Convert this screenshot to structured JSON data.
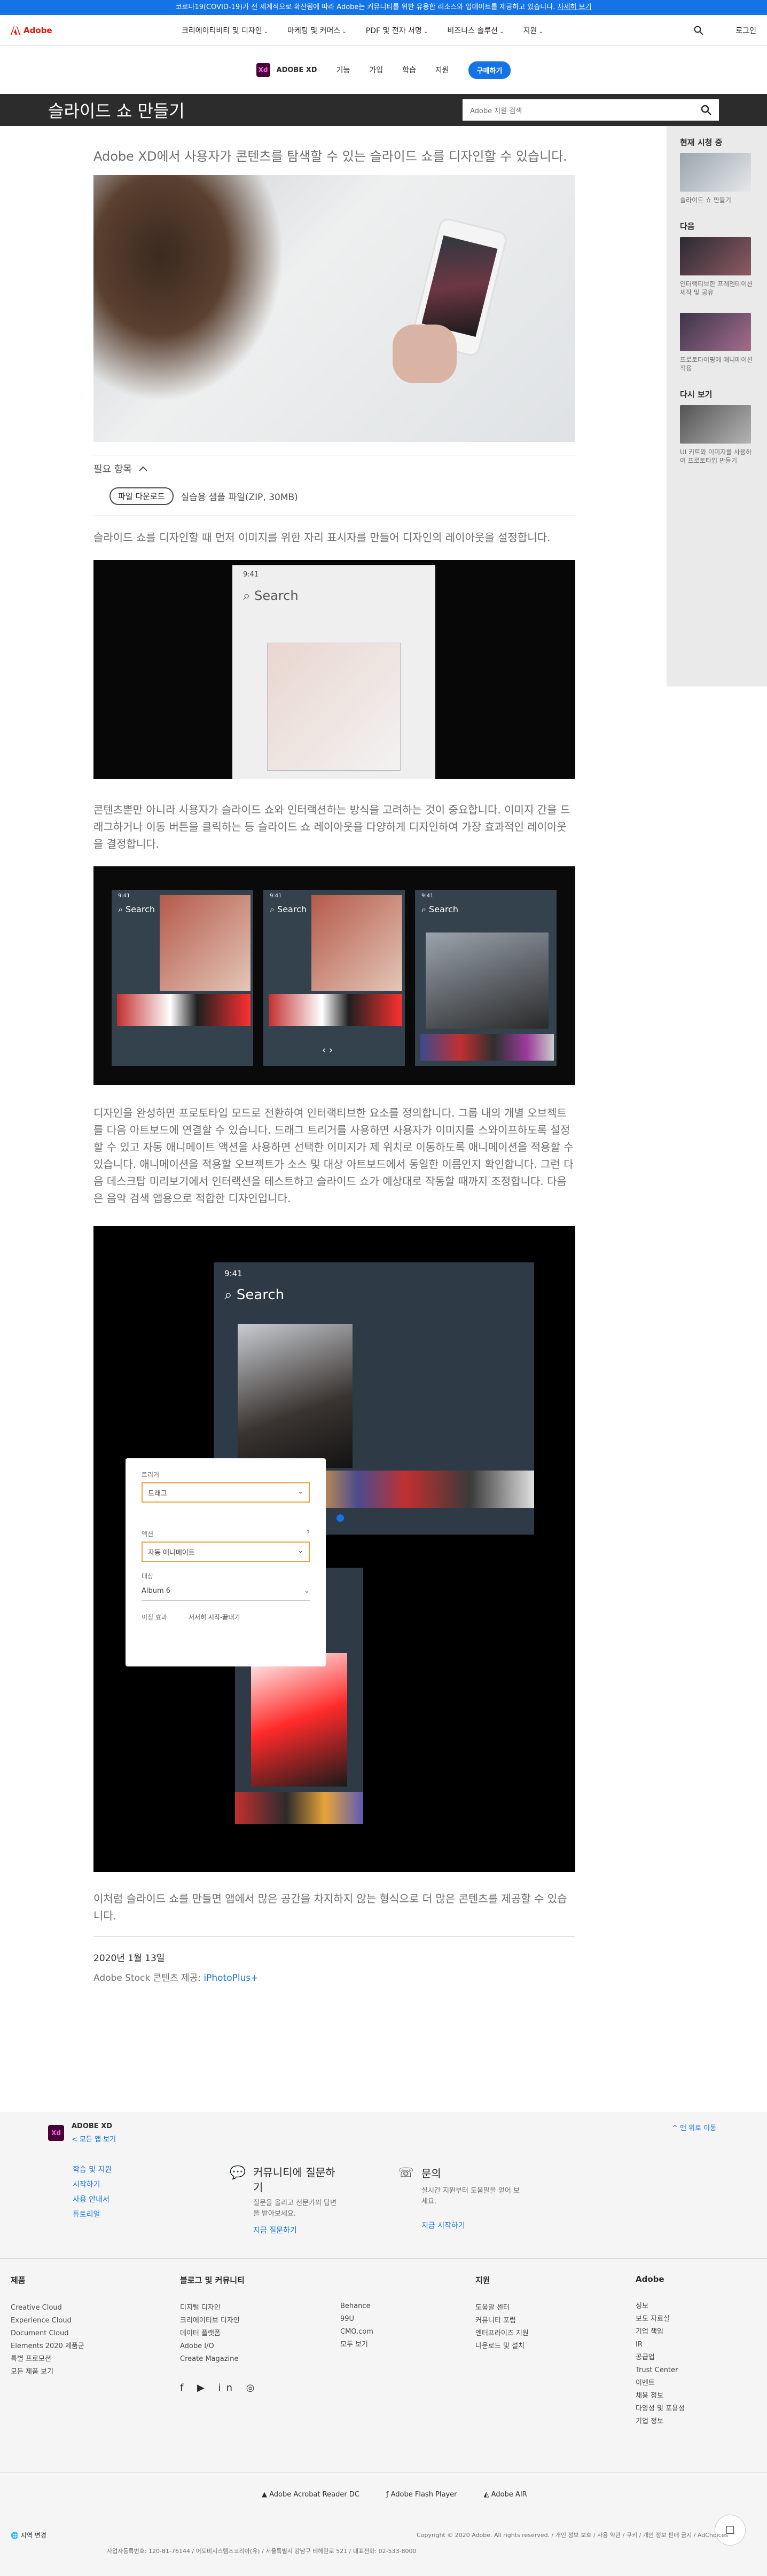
{
  "banner": {
    "text": "코로나19(COVID-19)가 전 세계적으로 확산됨에 따라 Adobe는 커뮤니티를 위한 유용한 리소스와 업데이트를 제공하고 있습니다.",
    "link": "자세히 보기"
  },
  "gnav": {
    "brand": "Adobe",
    "items": [
      "크리에이티비티 및 디자인",
      "마케팅 및 커머스",
      "PDF 및 전자 서명",
      "비즈니스 솔루션",
      "지원"
    ],
    "signin": "로그인"
  },
  "subnav": {
    "product": "ADOBE XD",
    "items": [
      "기능",
      "가입",
      "학습",
      "지원"
    ],
    "buy": "구매하기"
  },
  "title": {
    "heading": "슬라이드 쇼 만들기",
    "search_placeholder": "Adobe 지원 검색"
  },
  "side": {
    "now": "현재 시청 중",
    "now_item": "슬라이드 쇼 만들기",
    "next": "다음",
    "next_items": [
      "인터랙티브한 프레젠테이션 제작 및 공유",
      "프로토타이핑에 애니메이션 적용"
    ],
    "review": "다시 보기",
    "review_item": "UI 키트와 이미지를 사용하여 프로토타입 만들기"
  },
  "article": {
    "lead": "Adobe XD에서 사용자가 콘텐츠를 탐색할 수 있는 슬라이드 쇼를 디자인할 수 있습니다.",
    "required": "필요 항목",
    "download_btn": "파일 다운로드",
    "download_text": "실습용 샘플 파일(ZIP, 30MB)",
    "para1": "슬라이드 쇼를 디자인할 때 먼저 이미지를 위한 자리 표시자를 만들어 디자인의 레이아웃을 설정합니다.",
    "para2": "콘텐츠뿐만 아니라 사용자가 슬라이드 쇼와 인터랙션하는 방식을 고려하는 것이 중요합니다. 이미지 간을 드래그하거나 이동 버튼을 클릭하는 등 슬라이드 쇼 레이아웃을 다양하게 디자인하여 가장 효과적인 레이아웃을 결정합니다.",
    "para3": "디자인을 완성하면 프로토타입 모드로 전환하여 인터랙티브한 요소를 정의합니다. 그룹 내의 개별 오브젝트를 다음 아트보드에 연결할 수 있습니다. 드래그 트리거를 사용하면 사용자가 이미지를 스와이프하도록 설정할 수 있고 자동 애니메이트 액션을 사용하면 선택한 이미지가 제 위치로 이동하도록 애니메이션을 적용할 수 있습니다. 애니메이션을 적용할 오브젝트가 소스 및 대상 아트보드에서 동일한 이름인지 확인합니다. 그런 다음 데스크탑 미리보기에서 인터랙션을 테스트하고 슬라이드 쇼가 예상대로 작동할 때까지 조정합니다. 다음은 음악 검색 앱용으로 적합한 디자인입니다.",
    "para4": "이처럼 슬라이드 쇼를 만들면 앱에서 많은 공간을 차지하지 않는 형식으로 더 많은 콘텐츠를 제공할 수 있습니다.",
    "date": "2020년 1월 13일",
    "credit_prefix": "Adobe Stock 콘텐츠 제공:",
    "credit_link": "iPhotoPlus+"
  },
  "mock": {
    "time": "9:41",
    "search": "Search"
  },
  "panel": {
    "trigger_label": "트리거",
    "trigger": "드래그",
    "action_label": "액션",
    "action": "자동 애니메이트",
    "dest_label": "대상",
    "dest": "Album 6",
    "ease_label": "이징 효과",
    "ease": "서서히 시작-끝내기"
  },
  "footer": {
    "product": "ADOBE XD",
    "back": "< 모든 앱 보기",
    "links": [
      "학습 및 지원",
      "시작하기",
      "사용 안내서",
      "튜토리얼"
    ],
    "community_title": "커뮤니티에 질문하기",
    "community_text": "질문을 올리고 전문가의 답변을 받아보세요.",
    "community_link": "지금 질문하기",
    "contact_title": "문의",
    "contact_text": "실시간 지원부터 도움말을 얻어 보세요.",
    "contact_link": "지금 시작하기",
    "top": "^ 맨 위로 이동",
    "cols": [
      {
        "title": "제품",
        "items": [
          "Creative Cloud",
          "Experience Cloud",
          "Document Cloud",
          "Elements 2020 제품군",
          "특별 프로모션",
          "모든 제품 보기"
        ]
      },
      {
        "title": "블로그 및 커뮤니티",
        "items": [
          "디지털 디자인",
          "크리에이티브 디자인",
          "데이터 플랫폼",
          "Adobe I/O",
          "Create Magazine"
        ]
      },
      {
        "title": "",
        "items": [
          "Behance",
          "99U",
          "CMO.com",
          "모두 보기"
        ]
      },
      {
        "title": "지원",
        "items": [
          "도움말 센터",
          "커뮤니티 포럼",
          "엔터프라이즈 지원",
          "다운로드 및 설치"
        ]
      },
      {
        "title": "Adobe",
        "items": [
          "정보",
          "보도 자료실",
          "기업 책임",
          "IR",
          "공급업",
          "Trust Center",
          "이벤트",
          "채용 정보",
          "다양성 및 포용성",
          "기업 정보"
        ]
      }
    ],
    "players": [
      "Adobe Acrobat Reader DC",
      "Adobe Flash Player",
      "Adobe AIR"
    ],
    "region": "지역 변경",
    "copyright": "Copyright © 2020 Adobe. All rights reserved. / 개인 정보 보호 / 사용 약관 / 쿠키 / 개인 정보 판매 금지 / AdChoices",
    "biz": "사업자등록번호: 120-81-76144 / 어도비시스템즈코리아(유) / 서울특별시 강남구 테헤란로 521 / 대표전화: 02-533-8000"
  }
}
